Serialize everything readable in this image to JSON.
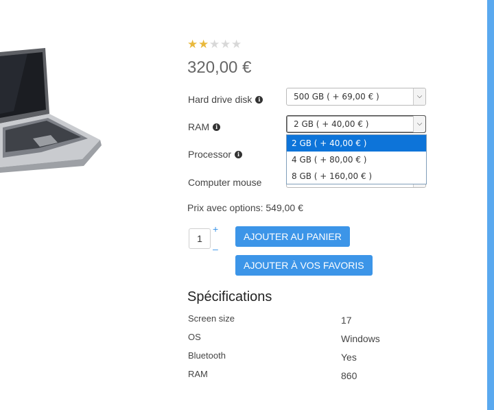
{
  "product": {
    "rating": {
      "value": 2,
      "max": 5
    },
    "price": "320,00 €"
  },
  "options": [
    {
      "label": "Hard drive disk",
      "value": "500 GB ( + 69,00 € )"
    },
    {
      "label": "RAM",
      "value": "2 GB ( + 40,00 € )"
    },
    {
      "label": "Processor",
      "value": ""
    },
    {
      "label": "Computer mouse",
      "value": ""
    }
  ],
  "ram_dropdown": {
    "options": [
      "2 GB ( + 40,00 € )",
      "4 GB ( + 80,00 € )",
      "8 GB ( + 160,00 € )"
    ],
    "selected_index": 0
  },
  "prix_options": "Prix avec options: 549,00 €",
  "quantity": {
    "value": "1",
    "plus": "+",
    "minus": "–"
  },
  "buttons": {
    "add_cart": "AJOUTER AU PANIER",
    "add_favorites": "AJOUTER À VOS FAVORIS"
  },
  "specs": {
    "title": "Spécifications",
    "rows": [
      {
        "name": "Screen size",
        "value": "17"
      },
      {
        "name": "OS",
        "value": "Windows"
      },
      {
        "name": "Bluetooth",
        "value": "Yes"
      },
      {
        "name": "RAM",
        "value": "860"
      }
    ]
  },
  "colors": {
    "accent": "#3c95e8",
    "selected": "#0d74d9",
    "star": "#e9b93c"
  }
}
